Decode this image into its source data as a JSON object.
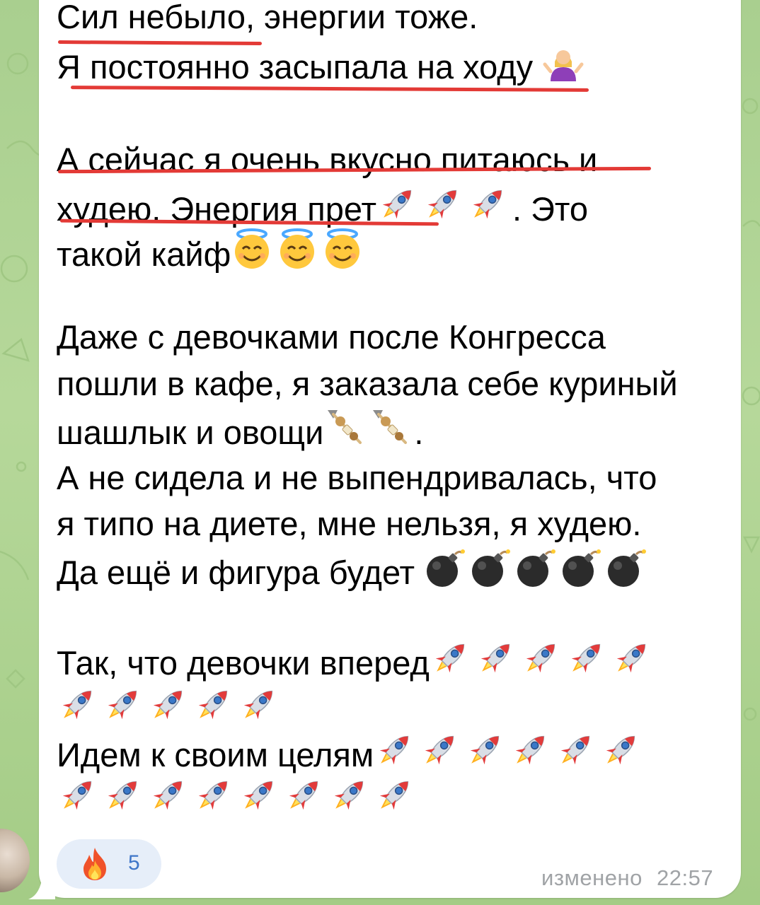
{
  "message": {
    "line_01": "Сил небыло, энергии тоже.",
    "line_02": "Я постоянно засыпала на ходу",
    "line_03": "А сейчас я очень  вкусно питаюсь и",
    "line_04a": "худею.  Энергия прет",
    "line_04b": ". Это",
    "line_05": "такой кайф",
    "line_06": "Даже с девочками после Конгресса",
    "line_07": "пошли в кафе, я заказала себе куриный",
    "line_08a": "шашлык и овощи",
    "line_08b": ".",
    "line_09": "А не сидела и не выпендривалась, что",
    "line_10": "я типо на диете, мне нельзя, я худею.",
    "line_11": "Да ещё и фигура будет ",
    "line_12": "Так, что девочки вперед",
    "line_13": "Идем к своим целям"
  },
  "emoji": {
    "shrug": "person-shrugging-icon",
    "rocket": "rocket-icon",
    "halo": "smiling-face-with-halo-icon",
    "skewer": "oden-skewer-icon",
    "bomb": "bomb-icon",
    "fire": "fire-icon"
  },
  "reaction": {
    "count": "5"
  },
  "meta": {
    "edited_label": "изменено",
    "time": "22:57"
  },
  "colors": {
    "underline": "#e33a36",
    "reaction_bg": "#e6eef9",
    "reaction_text": "#3f76c8",
    "meta_text": "#a0a3a6",
    "chat_bg": "#b6d89a"
  }
}
